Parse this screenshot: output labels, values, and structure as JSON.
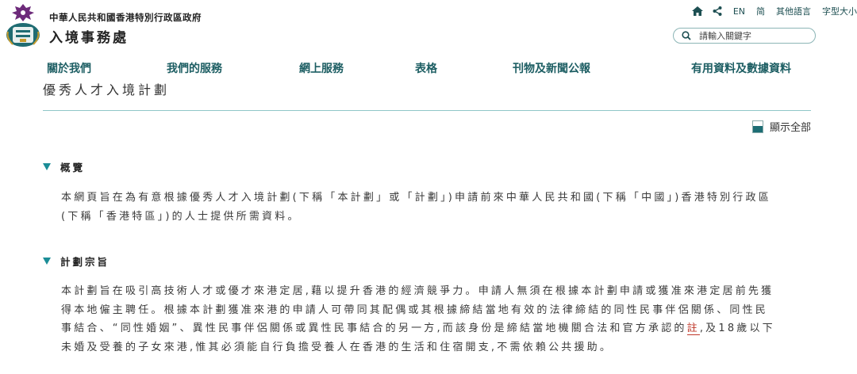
{
  "header": {
    "gov_name": "中華人民共和國香港特別行政區政府",
    "dept_name": "入境事務處",
    "toplinks": {
      "lang_en": "EN",
      "lang_simplified": "简",
      "other_languages": "其他語言",
      "font_size": "字型大小"
    },
    "search_placeholder": "請輸入關鍵字",
    "nav": [
      "關於我們",
      "我們的服務",
      "網上服務",
      "表格",
      "刊物及新聞公報",
      "有用資料及數據資料"
    ]
  },
  "main": {
    "page_title": "優秀人才入境計劃",
    "show_all_label": "顯示全部",
    "sections": [
      {
        "title": "概覽",
        "body": "本網頁旨在為有意根據優秀人才入境計劃(下稱「本計劃」或「計劃」)申請前來中華人民共和國(下稱「中國」)香港特別行政區(下稱「香港特區」)的人士提供所需資料。"
      },
      {
        "title": "計劃宗旨",
        "body_before_note": "本計劃旨在吸引高技術人才或優才來港定居,藉以提升香港的經濟競爭力。申請人無須在根據本計劃申請或獲准來港定居前先獲得本地僱主聘任。根據本計劃獲准來港的申請人可帶同其配偶或其根據締結當地有效的法律締結的同性民事伴侶關係、同性民事結合、“同性婚姻”、異性民事伴侶關係或異性民事結合的另一方,而該身份是締結當地機關合法和官方承認的",
        "note_link": "註",
        "body_after_note": ",及18歲以下未婚及受養的子女來港,惟其必須能自行負擔受養人在香港的生活和住宿開支,不需依賴公共援助。"
      }
    ]
  },
  "colors": {
    "accent": "#1b8d97",
    "nav_text": "#1d5e63",
    "rule": "#8fc7c8",
    "note": "#c0392b"
  },
  "icons": [
    "hkgov-emblem-logo",
    "home-icon",
    "share-icon",
    "search-icon",
    "show-all-icon",
    "expand-triangle-icon"
  ]
}
